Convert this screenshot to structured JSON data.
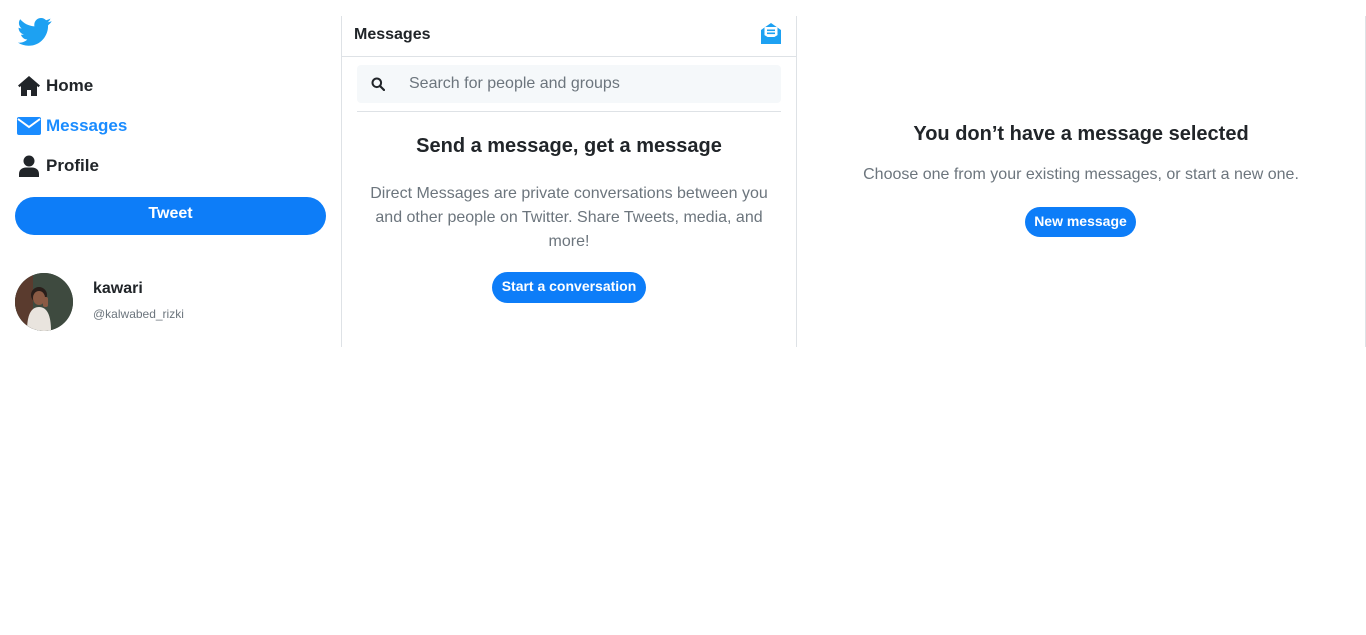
{
  "brand": {
    "logo_icon": "twitter-bird-icon",
    "accent": "#1da1f2",
    "primary": "#0d7df8"
  },
  "sidebar": {
    "items": [
      {
        "label": "Home",
        "icon": "home-icon",
        "active": false
      },
      {
        "label": "Messages",
        "icon": "envelope-icon",
        "active": true
      },
      {
        "label": "Profile",
        "icon": "user-icon",
        "active": false
      }
    ],
    "tweet_label": "Tweet",
    "user": {
      "name": "kawari",
      "handle": "@kalwabed_rizki"
    }
  },
  "messages": {
    "title": "Messages",
    "compose_icon": "new-message-icon",
    "search": {
      "placeholder": "Search for people and groups",
      "value": ""
    },
    "empty": {
      "title": "Send a message, get a message",
      "text": "Direct Messages are private conversations between you and other people on Twitter. Share Tweets, media, and more!",
      "button": "Start a conversation"
    }
  },
  "detail": {
    "title": "You don’t have a message selected",
    "text": "Choose one from your existing messages, or start a new one.",
    "button": "New message"
  }
}
